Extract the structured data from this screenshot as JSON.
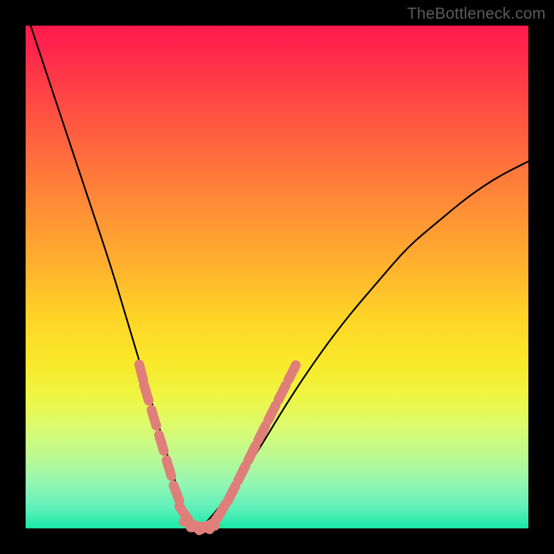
{
  "watermark": "TheBottleneck.com",
  "chart_data": {
    "type": "line",
    "title": "",
    "xlabel": "",
    "ylabel": "",
    "xlim": [
      0,
      100
    ],
    "ylim": [
      0,
      100
    ],
    "grid": false,
    "legend": false,
    "series": [
      {
        "name": "bottleneck-curve",
        "color": "#000000",
        "x": [
          1,
          5,
          9,
          13,
          17,
          20,
          23,
          26,
          29,
          31,
          33,
          35,
          40,
          46,
          52,
          58,
          64,
          70,
          76,
          82,
          88,
          94,
          100
        ],
        "y": [
          100,
          88,
          76,
          64,
          52,
          42,
          32,
          22,
          12,
          5,
          0,
          0,
          6,
          15,
          25,
          34,
          42,
          49,
          56,
          61,
          66,
          70,
          73
        ]
      }
    ],
    "markers": [
      {
        "name": "dotted-overlay-left",
        "shape": "capsule",
        "color": "#e07f7a",
        "points_xy": [
          [
            23,
            31
          ],
          [
            24,
            27
          ],
          [
            25.5,
            22
          ],
          [
            27,
            17
          ],
          [
            28.5,
            12
          ],
          [
            30,
            7
          ],
          [
            31.5,
            3
          ],
          [
            33,
            0.8
          ],
          [
            34.5,
            0.3
          ],
          [
            36,
            0.4
          ]
        ]
      },
      {
        "name": "dotted-overlay-right",
        "shape": "capsule",
        "color": "#e07f7a",
        "points_xy": [
          [
            36,
            0.4
          ],
          [
            37.5,
            1.2
          ],
          [
            39,
            3.5
          ],
          [
            41,
            7
          ],
          [
            43,
            11
          ],
          [
            45,
            15
          ],
          [
            47,
            19
          ],
          [
            49,
            23
          ],
          [
            51,
            27
          ],
          [
            53,
            31
          ]
        ]
      }
    ],
    "gradient_stops": [
      {
        "pos": 0.0,
        "color": "#ff1a4d"
      },
      {
        "pos": 0.25,
        "color": "#ff6a3e"
      },
      {
        "pos": 0.5,
        "color": "#ffbf2b"
      },
      {
        "pos": 0.7,
        "color": "#f3ef38"
      },
      {
        "pos": 0.88,
        "color": "#a6f79f"
      },
      {
        "pos": 1.0,
        "color": "#18e9a5"
      }
    ]
  }
}
